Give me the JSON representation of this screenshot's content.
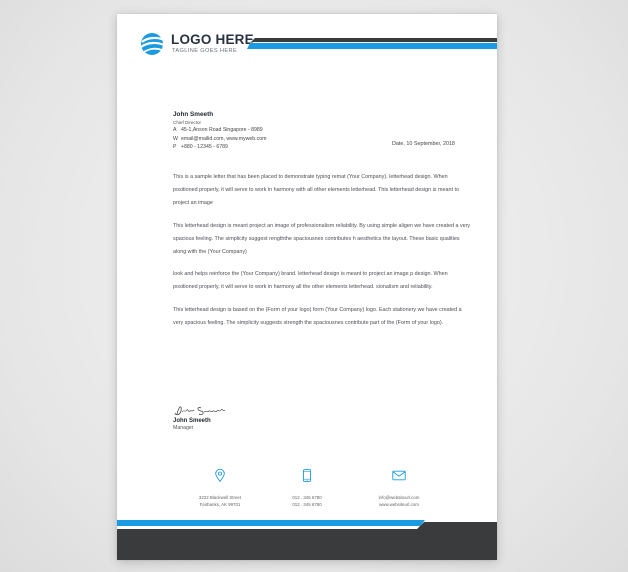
{
  "logo": {
    "name": "LOGO HERE",
    "tagline": "TAGLINE GOES HERE"
  },
  "colors": {
    "accent": "#1a9ae0",
    "dark": "#3a3b3d",
    "text": "#4b4f55"
  },
  "sender": {
    "name": "John Smeeth",
    "title": "Chief Director",
    "address_key": "A",
    "address": "45-1,Anson Road Singapore - 8989",
    "web_key": "W",
    "web": "email@mailid.com, www.myweb.com",
    "phone_key": "P",
    "phone": "+880 - 12345 - 6789"
  },
  "date": "Date, 10 September, 2018",
  "body": {
    "p1": "This is a sample letter that has been placed to demonstrate typing remat (Your Company). letterhead design. When positioned properly, it will serve to work in harmony with all other elements letterhead. This letterhead design is meant to project an image",
    "p2": "This letterhead design is meant project an image of professionalism reliability. By using simple aligen we have created a very spacious feeling. The simplicity suggest  rengththe spaciousnes contributes h aesthetics the layout. These basic qualities along with the (Your Company)",
    "p3": "look and helps reinforce the (Your Company) brand. letterhead design is meant to project an image p design. When positioned properly, it will serve to work in harmony all the other elements letterhead. sionalism and reliability.",
    "p4": "This letterhead design is based on the (Form of your logo) form (Your Company) logo. Each stationery we have created a very spacious feeling. The simplicity suggests strength the spaciousnes contribute part of the (Form of your logo)."
  },
  "signature": {
    "script": "John Smeeth",
    "name": "John Smeeth",
    "title": "Manager"
  },
  "footer": {
    "address": {
      "icon": "location-pin-icon",
      "line1": "3222 Blackwell Street",
      "line2": "Fairbanks, AK 99701"
    },
    "phone": {
      "icon": "phone-icon",
      "line1": "012 . 345 6780",
      "line2": "012 . 345 6780"
    },
    "email": {
      "icon": "envelope-icon",
      "line1": "info@websiteurl.com",
      "line2": "www.websiteurl.com"
    }
  }
}
